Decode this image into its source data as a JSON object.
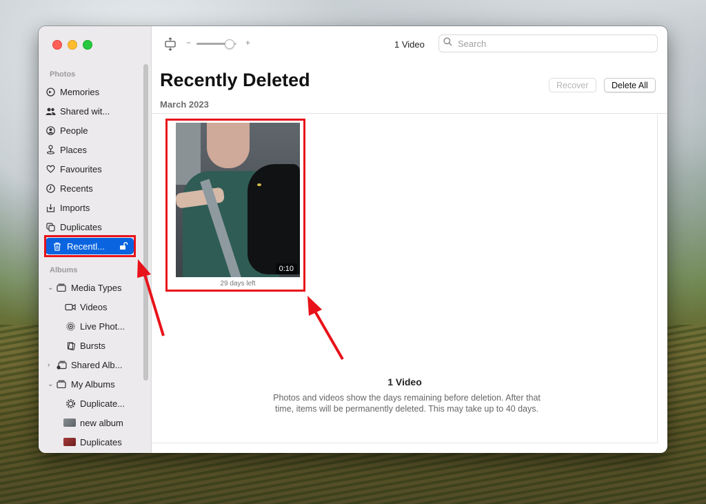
{
  "sidebar": {
    "photos_header": "Photos",
    "albums_header": "Albums",
    "items": [
      {
        "label": "Memories",
        "icon": "memories-icon"
      },
      {
        "label": "Shared wit...",
        "icon": "shared-with-you-icon"
      },
      {
        "label": "People",
        "icon": "people-icon"
      },
      {
        "label": "Places",
        "icon": "places-icon"
      },
      {
        "label": "Favourites",
        "icon": "heart-icon"
      },
      {
        "label": "Recents",
        "icon": "clock-icon"
      },
      {
        "label": "Imports",
        "icon": "import-icon"
      },
      {
        "label": "Duplicates",
        "icon": "duplicates-icon"
      },
      {
        "label": "Recentl...",
        "icon": "trash-icon",
        "selected": true
      }
    ],
    "albums": [
      {
        "label": "Media Types",
        "icon": "folder-icon",
        "expanded": true
      },
      {
        "label": "Videos",
        "icon": "video-camera-icon"
      },
      {
        "label": "Live Phot...",
        "icon": "live-photo-icon"
      },
      {
        "label": "Bursts",
        "icon": "bursts-icon"
      },
      {
        "label": "Shared Alb...",
        "icon": "shared-albums-icon",
        "expanded": false
      },
      {
        "label": "My Albums",
        "icon": "folder-icon",
        "expanded": true
      },
      {
        "label": "Duplicate...",
        "icon": "smart-album-gear-icon"
      },
      {
        "label": "new album",
        "icon": "album-thumbnail-icon"
      },
      {
        "label": "Duplicates",
        "icon": "album-thumbnail-icon"
      }
    ]
  },
  "toolbar": {
    "zoom_minus": "−",
    "zoom_plus": "+",
    "zoom_level": 0.9,
    "item_count": "1 Video",
    "search_placeholder": "Search"
  },
  "main": {
    "title": "Recently Deleted",
    "date_section": "March 2023",
    "recover_label": "Recover",
    "delete_all_label": "Delete All",
    "video": {
      "duration": "0:10",
      "days_left": "29 days left"
    },
    "info_title": "1 Video",
    "info_text": "Photos and videos show the days remaining before deletion. After that time, items will be permanently deleted. This may take up to 40 days."
  },
  "colors": {
    "selection_blue": "#0a64e0",
    "highlight_red": "#e8121a"
  }
}
